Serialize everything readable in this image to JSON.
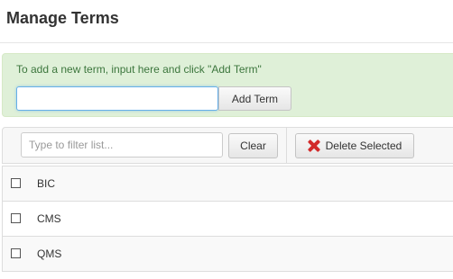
{
  "page": {
    "title": "Manage Terms"
  },
  "add_term": {
    "instructions": "To add a new term, input here and click \"Add Term\"",
    "input_value": "",
    "input_placeholder": "",
    "button_label": "Add Term"
  },
  "toolbar": {
    "filter_placeholder": "Type to filter list...",
    "filter_value": "",
    "clear_label": "Clear",
    "delete_label": "Delete Selected",
    "delete_icon": "red-x-icon"
  },
  "terms": [
    {
      "label": "BIC",
      "checked": false
    },
    {
      "label": "CMS",
      "checked": false
    },
    {
      "label": "QMS",
      "checked": false
    }
  ],
  "colors": {
    "panel_background": "#dff0d8",
    "panel_text": "#3c763d",
    "delete_icon": "#d22b2b"
  }
}
